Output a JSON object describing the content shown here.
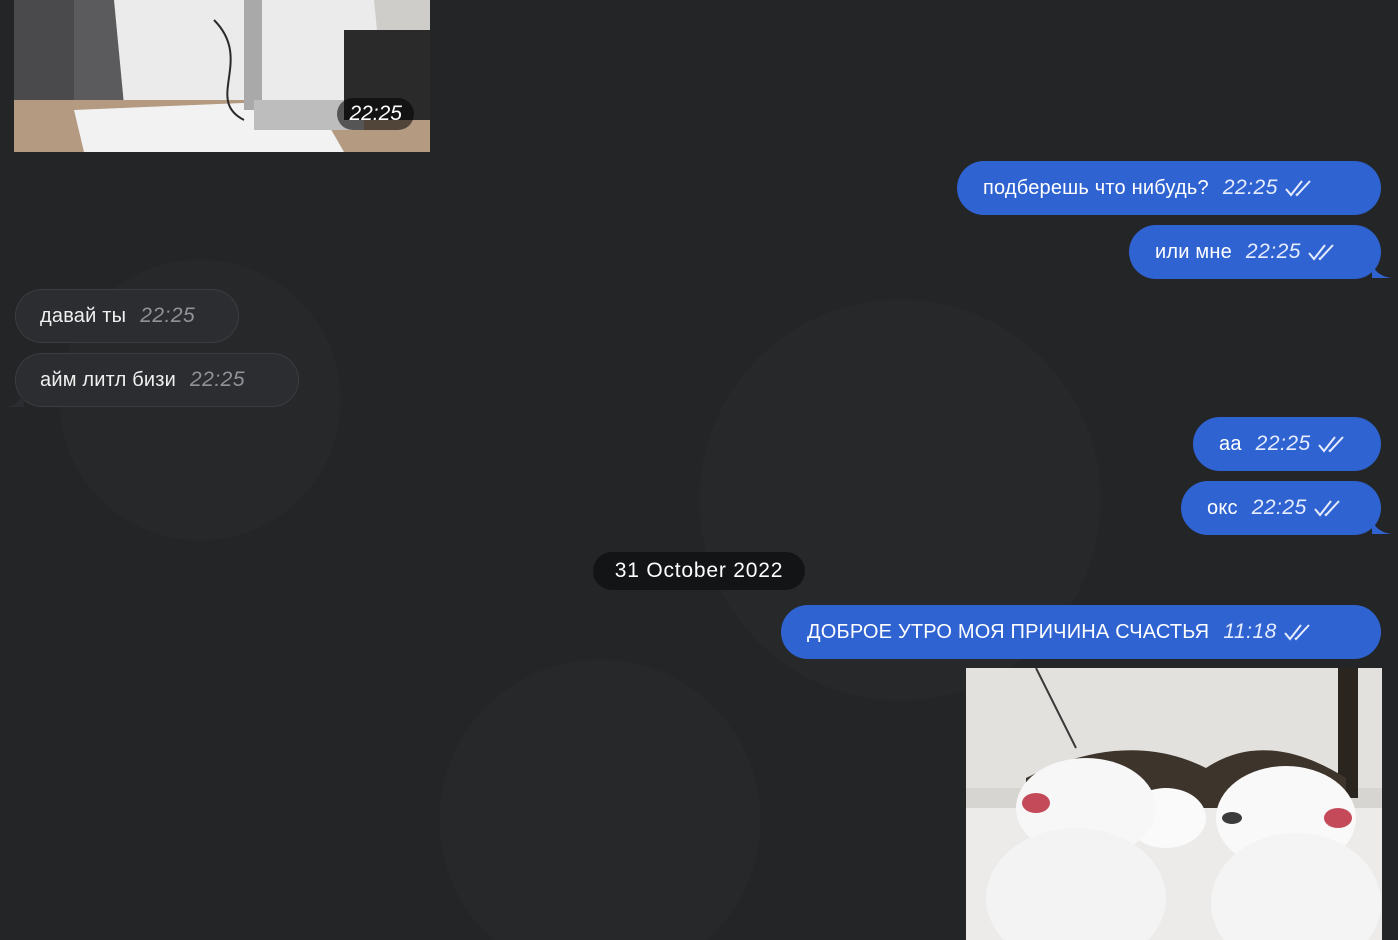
{
  "media_top": {
    "time": "22:25"
  },
  "messages": {
    "m1": {
      "text": "подберешь что нибудь?",
      "time": "22:25"
    },
    "m2": {
      "text": "или мне",
      "time": "22:25"
    },
    "m3": {
      "text": "давай ты",
      "time": "22:25"
    },
    "m4": {
      "text": "айм литл бизи",
      "time": "22:25"
    },
    "m5": {
      "text": "аа",
      "time": "22:25"
    },
    "m6": {
      "text": "окс",
      "time": "22:25"
    },
    "m7": {
      "text": "ДОБРОЕ УТРО МОЯ ПРИЧИНА СЧАСТЬЯ",
      "time": "11:18"
    }
  },
  "date_divider": "31 October 2022",
  "icons": {
    "read_receipt": "double-check-icon"
  },
  "colors": {
    "background": "#232527",
    "outgoing": "#2f63d1",
    "incoming": "#2b2d30",
    "date_pill": "#121416"
  }
}
